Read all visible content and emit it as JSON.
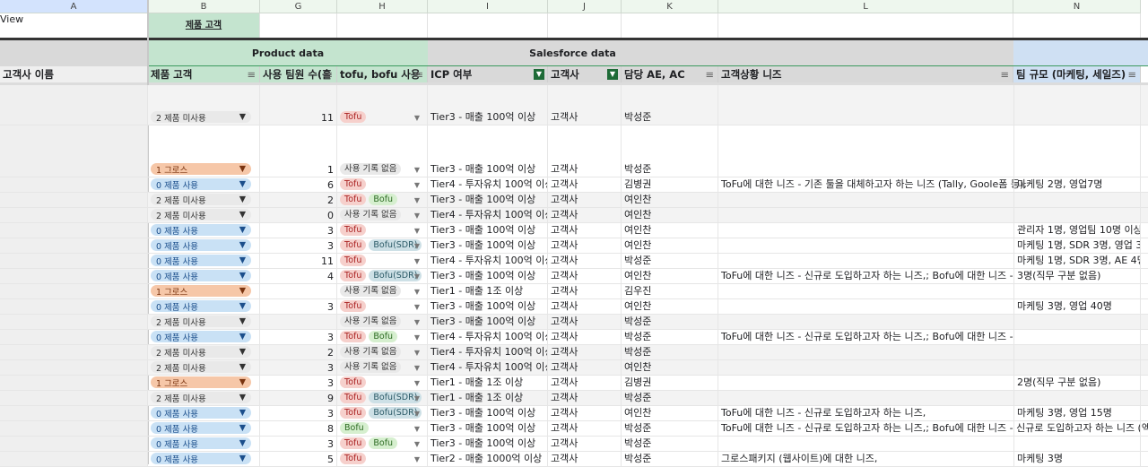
{
  "columns": [
    "A",
    "B",
    "G",
    "H",
    "I",
    "J",
    "K",
    "L",
    "N"
  ],
  "view_label": "View",
  "b1_label": "제품 고객",
  "groups": {
    "product": "Product data",
    "salesforce": "Salesforce data"
  },
  "headers": [
    "고객사 이름",
    "제품 고객",
    "사용 팀원 수(홀",
    "tofu, bofu 사용",
    "ICP 여부",
    "고객사",
    "담당 AE, AC",
    "고객상황 니즈",
    "팀 규모 (마케팅, 세일즈)"
  ],
  "colors": {
    "product_green": "#c4e4cf",
    "salesforce_gray": "#d9d9d9",
    "team_blue": "#cfe0f3",
    "filter_active": "#1e6b37"
  },
  "status_labels": {
    "0": "0 제품 사용",
    "1": "1 그로스",
    "2": "2 제품 미사용"
  },
  "rows": [
    {
      "s": "2",
      "n": "11",
      "t": [
        "Tofu"
      ],
      "icp": "Tier3 - 매출 100억 이상",
      "co": "고객사",
      "ae": "박성준",
      "need": "",
      "team": ""
    },
    {
      "s": "1",
      "n": "1",
      "t": [
        "사용 기록 없음"
      ],
      "icp": "Tier3 - 매출 100억 이상",
      "co": "고객사",
      "ae": "박성준",
      "need": "",
      "team": ""
    },
    {
      "s": "0",
      "n": "6",
      "t": [
        "Tofu"
      ],
      "icp": "Tier4 - 투자유치 100억 이상",
      "co": "고객사",
      "ae": "김병권",
      "need": "ToFu에 대한 니즈 - 기존 툴을 대체하고자 하는 니즈 (Tally, Goole폼 등),",
      "team": "마케팅 2명, 영업7명"
    },
    {
      "s": "2",
      "n": "2",
      "t": [
        "Tofu",
        "Bofu"
      ],
      "icp": "Tier3 - 매출 100억 이상",
      "co": "고객사",
      "ae": "여인찬",
      "need": "",
      "team": ""
    },
    {
      "s": "2",
      "n": "0",
      "t": [
        "사용 기록 없음"
      ],
      "icp": "Tier4 - 투자유치 100억 이상",
      "co": "고객사",
      "ae": "여인찬",
      "need": "",
      "team": ""
    },
    {
      "s": "0",
      "n": "3",
      "t": [
        "Tofu"
      ],
      "icp": "Tier3 - 매출 100억 이상",
      "co": "고객사",
      "ae": "여인찬",
      "need": "",
      "team": "관리자 1명, 영업팀 10명 이상"
    },
    {
      "s": "0",
      "n": "3",
      "t": [
        "Tofu",
        "Bofu(SDR)"
      ],
      "icp": "Tier3 - 매출 100억 이상",
      "co": "고객사",
      "ae": "여인찬",
      "need": "",
      "team": "마케팅 1명, SDR 3명, 영업 3명"
    },
    {
      "s": "0",
      "n": "11",
      "t": [
        "Tofu"
      ],
      "icp": "Tier4 - 투자유치 100억 이상",
      "co": "고객사",
      "ae": "박성준",
      "need": "",
      "team": "마케팅 1명, SDR 3명, AE 4명"
    },
    {
      "s": "0",
      "n": "4",
      "t": [
        "Tofu",
        "Bofu(SDR)"
      ],
      "icp": "Tier3 - 매출 100억 이상",
      "co": "고객사",
      "ae": "여인찬",
      "need": "ToFu에 대한 니즈 - 신규로 도입하고자 하는 니즈,; Bofu에 대한 니즈 -",
      "team": "3명(직무 구분 없음)"
    },
    {
      "s": "1",
      "n": "",
      "t": [
        "사용 기록 없음"
      ],
      "icp": "Tier1 - 매출 1조 이상",
      "co": "고객사",
      "ae": "김우진",
      "need": "",
      "team": ""
    },
    {
      "s": "0",
      "n": "3",
      "t": [
        "Tofu"
      ],
      "icp": "Tier3 - 매출 100억 이상",
      "co": "고객사",
      "ae": "여인찬",
      "need": "",
      "team": "마케팅 3명, 영업 40명"
    },
    {
      "s": "2",
      "n": "",
      "t": [
        "사용 기록 없음"
      ],
      "icp": "Tier3 - 매출 100억 이상",
      "co": "고객사",
      "ae": "박성준",
      "need": "",
      "team": ""
    },
    {
      "s": "0",
      "n": "3",
      "t": [
        "Tofu",
        "Bofu"
      ],
      "icp": "Tier4 - 투자유치 100억 이상",
      "co": "고객사",
      "ae": "박성준",
      "need": "ToFu에 대한 니즈 - 신규로 도입하고자 하는 니즈,; Bofu에 대한 니즈 -",
      "team": ""
    },
    {
      "s": "2",
      "n": "2",
      "t": [
        "사용 기록 없음"
      ],
      "icp": "Tier4 - 투자유치 100억 이상",
      "co": "고객사",
      "ae": "박성준",
      "need": "",
      "team": ""
    },
    {
      "s": "2",
      "n": "3",
      "t": [
        "사용 기록 없음"
      ],
      "icp": "Tier4 - 투자유치 100억 이상",
      "co": "고객사",
      "ae": "여인찬",
      "need": "",
      "team": ""
    },
    {
      "s": "1",
      "n": "3",
      "t": [
        "Tofu"
      ],
      "icp": "Tier1 - 매출 1조 이상",
      "co": "고객사",
      "ae": "김병권",
      "need": "",
      "team": "2명(직무 구분 없음)"
    },
    {
      "s": "2",
      "n": "9",
      "t": [
        "Tofu",
        "Bofu(SDR)"
      ],
      "icp": "Tier1 - 매출 1조 이상",
      "co": "고객사",
      "ae": "박성준",
      "need": "",
      "team": ""
    },
    {
      "s": "0",
      "n": "3",
      "t": [
        "Tofu",
        "Bofu(SDR)"
      ],
      "icp": "Tier3 - 매출 100억 이상",
      "co": "고객사",
      "ae": "여인찬",
      "need": "ToFu에 대한 니즈 - 신규로 도입하고자 하는 니즈,",
      "team": "마케팅 3명, 영업 15명"
    },
    {
      "s": "0",
      "n": "8",
      "t": [
        "Bofu"
      ],
      "icp": "Tier3 - 매출 100억 이상",
      "co": "고객사",
      "ae": "박성준",
      "need": "ToFu에 대한 니즈 - 신규로 도입하고자 하는 니즈,; Bofu에 대한 니즈 - 신규로 도입하고자 하는 니즈 (엑셀",
      "team": ""
    },
    {
      "s": "0",
      "n": "3",
      "t": [
        "Tofu",
        "Bofu"
      ],
      "icp": "Tier3 - 매출 100억 이상",
      "co": "고객사",
      "ae": "박성준",
      "need": "",
      "team": ""
    },
    {
      "s": "0",
      "n": "5",
      "t": [
        "Tofu"
      ],
      "icp": "Tier2 - 매출 1000억 이상",
      "co": "고객사",
      "ae": "박성준",
      "need": "그로스패키지 (웹사이트)에 대한 니즈,",
      "team": "마케팅 3명"
    }
  ]
}
